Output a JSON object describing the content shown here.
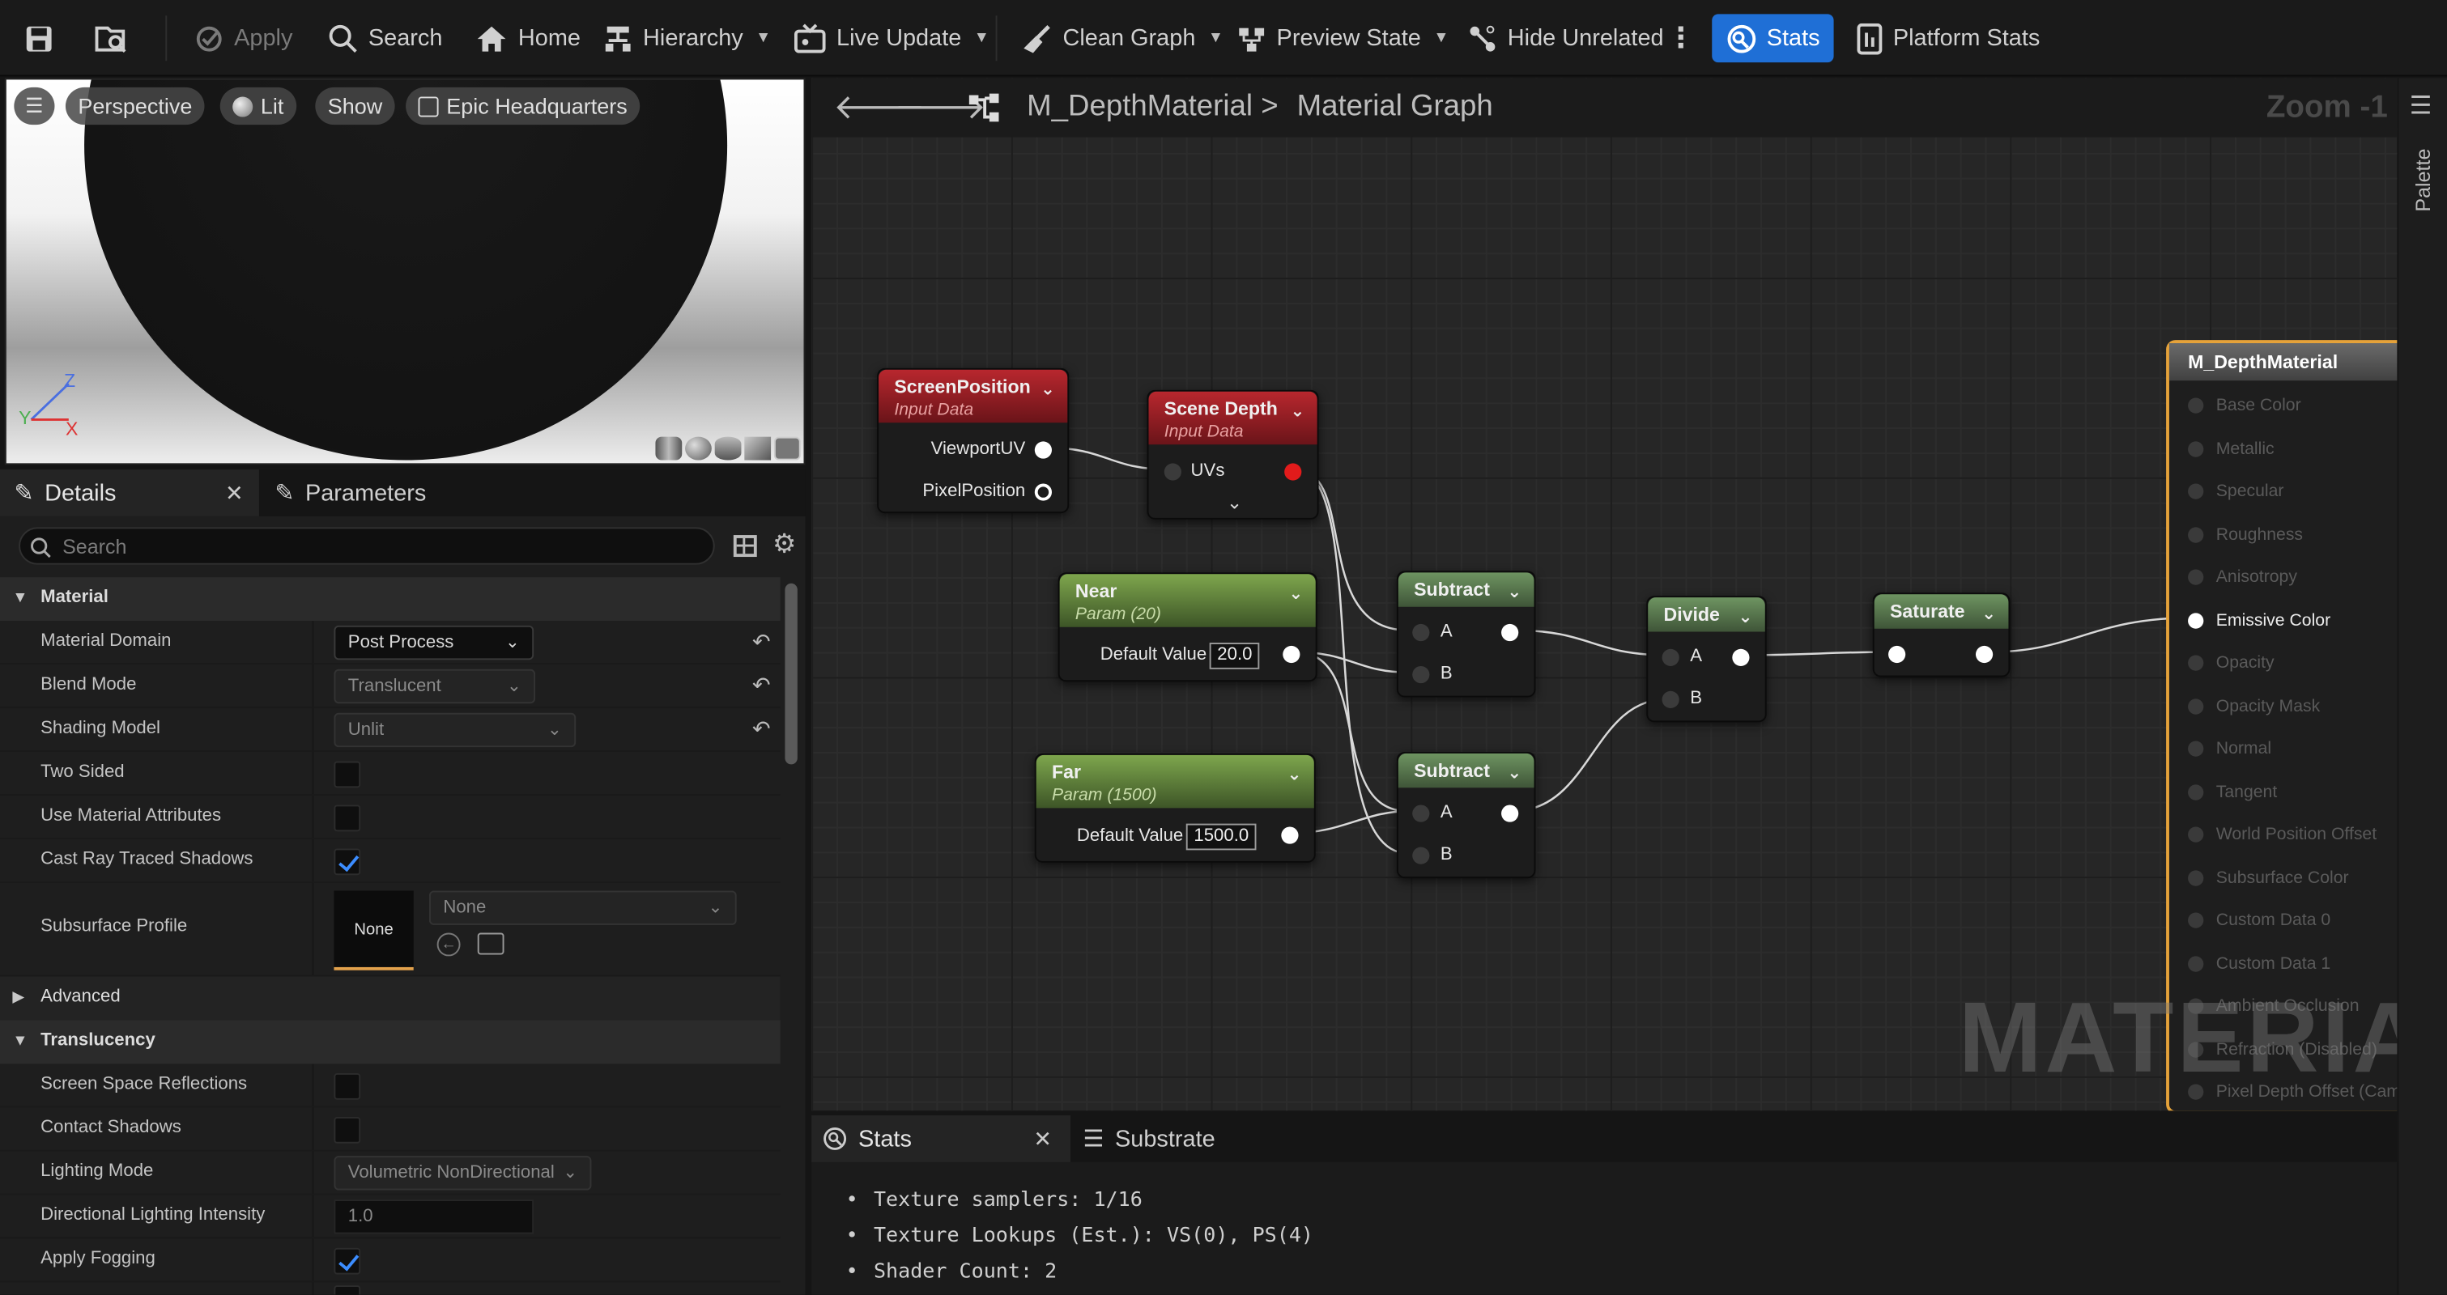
{
  "toolbar": {
    "apply": "Apply",
    "search": "Search",
    "home": "Home",
    "hierarchy": "Hierarchy",
    "live_update": "Live Update",
    "clean_graph": "Clean Graph",
    "preview_state": "Preview State",
    "hide_unrelated": "Hide Unrelated",
    "stats": "Stats",
    "platform_stats": "Platform Stats"
  },
  "viewport": {
    "perspective": "Perspective",
    "lit": "Lit",
    "show": "Show",
    "level": "Epic Headquarters",
    "axis_z": "Z",
    "axis_y": "Y",
    "axis_x": "X"
  },
  "details": {
    "tab_details": "Details",
    "tab_parameters": "Parameters",
    "search_placeholder": "Search",
    "sections": {
      "material": "Material",
      "advanced": "Advanced",
      "translucency": "Translucency"
    },
    "props": {
      "material_domain": {
        "label": "Material Domain",
        "value": "Post Process"
      },
      "blend_mode": {
        "label": "Blend Mode",
        "value": "Translucent"
      },
      "shading_model": {
        "label": "Shading Model",
        "value": "Unlit"
      },
      "two_sided": {
        "label": "Two Sided",
        "checked": false
      },
      "use_material_attributes": {
        "label": "Use Material Attributes",
        "checked": false
      },
      "cast_ray_traced_shadows": {
        "label": "Cast Ray Traced Shadows",
        "checked": true
      },
      "subsurface_profile": {
        "label": "Subsurface Profile",
        "thumb": "None",
        "value": "None"
      },
      "screen_space_reflections": {
        "label": "Screen Space Reflections",
        "checked": false
      },
      "contact_shadows": {
        "label": "Contact Shadows",
        "checked": false
      },
      "lighting_mode": {
        "label": "Lighting Mode",
        "value": "Volumetric NonDirectional"
      },
      "directional_lighting_intensity": {
        "label": "Directional Lighting Intensity",
        "value": "1.0"
      },
      "apply_fogging": {
        "label": "Apply Fogging",
        "checked": true
      }
    }
  },
  "graph": {
    "breadcrumb_asset": "M_DepthMaterial",
    "breadcrumb_sep": ">",
    "breadcrumb_graph": "Material Graph",
    "zoom": "Zoom -1",
    "watermark": "MATERIAL",
    "nodes": {
      "screen_position": {
        "title": "ScreenPosition",
        "subtitle": "Input Data",
        "pins": [
          "ViewportUV",
          "PixelPosition"
        ]
      },
      "scene_depth": {
        "title": "Scene Depth",
        "subtitle": "Input Data",
        "pin": "UVs"
      },
      "near": {
        "title": "Near",
        "subtitle": "Param (20)",
        "default_label": "Default Value",
        "default_value": "20.0"
      },
      "far": {
        "title": "Far",
        "subtitle": "Param (1500)",
        "default_label": "Default Value",
        "default_value": "1500.0"
      },
      "subtract1": {
        "title": "Subtract",
        "pin_a": "A",
        "pin_b": "B"
      },
      "subtract2": {
        "title": "Subtract",
        "pin_a": "A",
        "pin_b": "B"
      },
      "divide": {
        "title": "Divide",
        "pin_a": "A",
        "pin_b": "B"
      },
      "saturate": {
        "title": "Saturate"
      }
    },
    "material_node": {
      "title": "M_DepthMaterial",
      "pins": [
        "Base Color",
        "Metallic",
        "Specular",
        "Roughness",
        "Anisotropy",
        "Emissive Color",
        "Opacity",
        "Opacity Mask",
        "Normal",
        "Tangent",
        "World Position Offset",
        "Subsurface Color",
        "Custom Data 0",
        "Custom Data 1",
        "Ambient Occlusion",
        "Refraction (Disabled)",
        "Pixel Depth Offset (Cam"
      ],
      "active_pin": "Emissive Color"
    }
  },
  "palette": "Palette",
  "stats_panel": {
    "tab_stats": "Stats",
    "tab_substrate": "Substrate",
    "lines": [
      "Texture samplers: 1/16",
      "Texture Lookups (Est.): VS(0), PS(4)",
      "Shader Count: 2"
    ]
  },
  "colors": {
    "accent": "#1f6fd6",
    "output_border": "#e5a23a",
    "check": "#3c8dff"
  }
}
